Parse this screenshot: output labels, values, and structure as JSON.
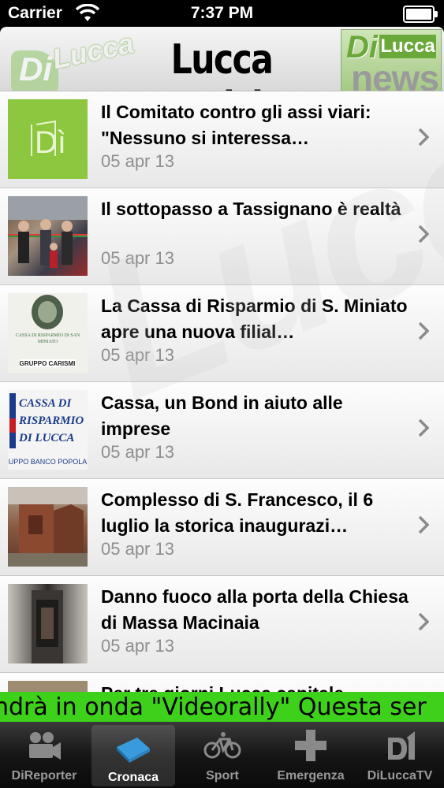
{
  "status_bar": {
    "carrier": "Carrier",
    "time": "7:37 PM"
  },
  "header": {
    "title": "Lucca Notizie",
    "logo_left": {
      "mark": "Di",
      "word": "Lucca"
    },
    "logo_right": {
      "mark": "Di",
      "word": "Lucca",
      "sub": "news"
    }
  },
  "watermark": "Lucca",
  "news": [
    {
      "title": "Il Comitato contro gli assi viari: \"Nessuno si interessa…",
      "date": "05 apr 13",
      "thumb": "dilucca-logo",
      "thumb_text": "Dì"
    },
    {
      "title": "Il sottopasso a Tassignano è realtà",
      "date": "05 apr 13",
      "thumb": "ribbon-cutting-photo",
      "thumb_text": ""
    },
    {
      "title": "La Cassa di Risparmio di S. Miniato apre una nuova filial…",
      "date": "05 apr 13",
      "thumb": "bank-seal",
      "thumb_text": "CASSA DI RISPARMIO DI SAN MINIATO"
    },
    {
      "title": "Cassa, un Bond in aiuto alle imprese",
      "date": "05 apr 13",
      "thumb": "bank-logo",
      "thumb_text": "CASSA DI RISPARMIO DI LUCCA PISA LIVORNO"
    },
    {
      "title": "Complesso di S. Francesco, il 6 luglio la storica inaugurazi…",
      "date": "05 apr 13",
      "thumb": "church-photo",
      "thumb_text": ""
    },
    {
      "title": "Danno fuoco alla porta della Chiesa di Massa Macinaia",
      "date": "05 apr 13",
      "thumb": "burnt-door-photo",
      "thumb_text": ""
    },
    {
      "title": "Per tre giorni Lucca capitale",
      "date": "",
      "thumb": "partial-photo",
      "thumb_text": ""
    }
  ],
  "ticker": {
    "text": "ndrà in onda \"Videorally\"  Questa ser"
  },
  "tabs": [
    {
      "label": "DiReporter",
      "icon": "video-camera-icon",
      "selected": false
    },
    {
      "label": "Cronaca",
      "icon": "newspaper-icon",
      "selected": true
    },
    {
      "label": "Sport",
      "icon": "bicycle-icon",
      "selected": false
    },
    {
      "label": "Emergenza",
      "icon": "medical-cross-icon",
      "selected": false
    },
    {
      "label": "DiLuccaTV",
      "icon": "dilucca-tv-icon",
      "selected": false
    }
  ],
  "colors": {
    "ticker_bg": "#3ed11c",
    "brand_green": "#8dc63f",
    "date_gray": "#8e8e8e"
  }
}
